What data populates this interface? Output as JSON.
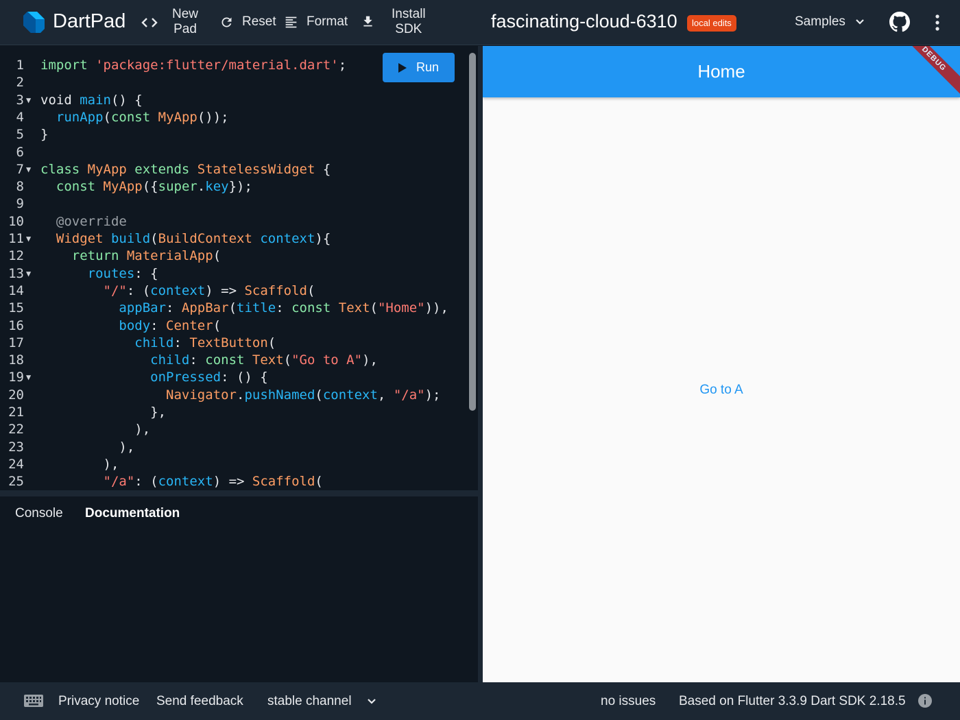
{
  "header": {
    "brand": "DartPad",
    "new_pad_line1": "New",
    "new_pad_line2": "Pad",
    "reset_label": "Reset",
    "format_label": "Format",
    "install_line1": "Install",
    "install_line2": "SDK",
    "pad_name": "fascinating-cloud-6310",
    "badge": "local edits",
    "samples_label": "Samples",
    "icons": [
      "dart-logo-icon",
      "code-brackets-icon",
      "refresh-icon",
      "format-align-icon",
      "download-icon",
      "chevron-down-icon",
      "github-icon",
      "more-vert-icon"
    ]
  },
  "editor": {
    "run_label": "Run",
    "lines": [
      {
        "n": "1",
        "fold": false,
        "tokens": [
          [
            "k-key",
            "import "
          ],
          [
            "k-str",
            "'package:flutter/material.dart'"
          ],
          [
            "k-p",
            ";"
          ]
        ]
      },
      {
        "n": "2",
        "fold": false,
        "tokens": []
      },
      {
        "n": "3",
        "fold": true,
        "tokens": [
          [
            "k-p",
            "void "
          ],
          [
            "k-fn",
            "main"
          ],
          [
            "k-p",
            "() {"
          ]
        ]
      },
      {
        "n": "4",
        "fold": false,
        "tokens": [
          [
            "k-p",
            "  "
          ],
          [
            "k-fn",
            "runApp"
          ],
          [
            "k-p",
            "("
          ],
          [
            "k-kw",
            "const "
          ],
          [
            "k-cls",
            "MyApp"
          ],
          [
            "k-p",
            "());"
          ]
        ]
      },
      {
        "n": "5",
        "fold": false,
        "tokens": [
          [
            "k-p",
            "}"
          ]
        ]
      },
      {
        "n": "6",
        "fold": false,
        "tokens": []
      },
      {
        "n": "7",
        "fold": true,
        "tokens": [
          [
            "k-kw",
            "class "
          ],
          [
            "k-cls",
            "MyApp "
          ],
          [
            "k-kw",
            "extends "
          ],
          [
            "k-cls",
            "StatelessWidget"
          ],
          [
            "k-p",
            " {"
          ]
        ]
      },
      {
        "n": "8",
        "fold": false,
        "tokens": [
          [
            "k-p",
            "  "
          ],
          [
            "k-kw",
            "const "
          ],
          [
            "k-cls",
            "MyApp"
          ],
          [
            "k-p",
            "({"
          ],
          [
            "k-kw",
            "super"
          ],
          [
            "k-p",
            "."
          ],
          [
            "k-fn",
            "key"
          ],
          [
            "k-p",
            "});"
          ]
        ]
      },
      {
        "n": "9",
        "fold": false,
        "tokens": []
      },
      {
        "n": "10",
        "fold": false,
        "tokens": [
          [
            "k-p",
            "  "
          ],
          [
            "k-cm",
            "@override"
          ]
        ]
      },
      {
        "n": "11",
        "fold": true,
        "tokens": [
          [
            "k-p",
            "  "
          ],
          [
            "k-cls",
            "Widget "
          ],
          [
            "k-fn",
            "build"
          ],
          [
            "k-p",
            "("
          ],
          [
            "k-cls",
            "BuildContext "
          ],
          [
            "k-fn",
            "context"
          ],
          [
            "k-p",
            "){"
          ]
        ]
      },
      {
        "n": "12",
        "fold": false,
        "tokens": [
          [
            "k-p",
            "    "
          ],
          [
            "k-kw",
            "return "
          ],
          [
            "k-cls",
            "MaterialApp"
          ],
          [
            "k-p",
            "("
          ]
        ]
      },
      {
        "n": "13",
        "fold": true,
        "tokens": [
          [
            "k-p",
            "      "
          ],
          [
            "k-fn",
            "routes"
          ],
          [
            "k-p",
            ": {"
          ]
        ]
      },
      {
        "n": "14",
        "fold": false,
        "tokens": [
          [
            "k-p",
            "        "
          ],
          [
            "k-str",
            "\"/\""
          ],
          [
            "k-p",
            ": ("
          ],
          [
            "k-fn",
            "context"
          ],
          [
            "k-p",
            ") => "
          ],
          [
            "k-cls",
            "Scaffold"
          ],
          [
            "k-p",
            "("
          ]
        ]
      },
      {
        "n": "15",
        "fold": false,
        "tokens": [
          [
            "k-p",
            "          "
          ],
          [
            "k-fn",
            "appBar"
          ],
          [
            "k-p",
            ": "
          ],
          [
            "k-cls",
            "AppBar"
          ],
          [
            "k-p",
            "("
          ],
          [
            "k-fn",
            "title"
          ],
          [
            "k-p",
            ": "
          ],
          [
            "k-kw",
            "const "
          ],
          [
            "k-cls",
            "Text"
          ],
          [
            "k-p",
            "("
          ],
          [
            "k-str",
            "\"Home\""
          ],
          [
            "k-p",
            ")),"
          ]
        ]
      },
      {
        "n": "16",
        "fold": false,
        "tokens": [
          [
            "k-p",
            "          "
          ],
          [
            "k-fn",
            "body"
          ],
          [
            "k-p",
            ": "
          ],
          [
            "k-cls",
            "Center"
          ],
          [
            "k-p",
            "("
          ]
        ]
      },
      {
        "n": "17",
        "fold": false,
        "tokens": [
          [
            "k-p",
            "            "
          ],
          [
            "k-fn",
            "child"
          ],
          [
            "k-p",
            ": "
          ],
          [
            "k-cls",
            "TextButton"
          ],
          [
            "k-p",
            "("
          ]
        ]
      },
      {
        "n": "18",
        "fold": false,
        "tokens": [
          [
            "k-p",
            "              "
          ],
          [
            "k-fn",
            "child"
          ],
          [
            "k-p",
            ": "
          ],
          [
            "k-kw",
            "const "
          ],
          [
            "k-cls",
            "Text"
          ],
          [
            "k-p",
            "("
          ],
          [
            "k-str",
            "\"Go to A\""
          ],
          [
            "k-p",
            "),"
          ]
        ]
      },
      {
        "n": "19",
        "fold": true,
        "tokens": [
          [
            "k-p",
            "              "
          ],
          [
            "k-fn",
            "onPressed"
          ],
          [
            "k-p",
            ": () {"
          ]
        ]
      },
      {
        "n": "20",
        "fold": false,
        "tokens": [
          [
            "k-p",
            "                "
          ],
          [
            "k-cls",
            "Navigator"
          ],
          [
            "k-p",
            "."
          ],
          [
            "k-fn",
            "pushNamed"
          ],
          [
            "k-p",
            "("
          ],
          [
            "k-fn",
            "context"
          ],
          [
            "k-p",
            ", "
          ],
          [
            "k-str",
            "\"/a\""
          ],
          [
            "k-p",
            ");"
          ]
        ]
      },
      {
        "n": "21",
        "fold": false,
        "tokens": [
          [
            "k-p",
            "              },"
          ]
        ]
      },
      {
        "n": "22",
        "fold": false,
        "tokens": [
          [
            "k-p",
            "            ),"
          ]
        ]
      },
      {
        "n": "23",
        "fold": false,
        "tokens": [
          [
            "k-p",
            "          ),"
          ]
        ]
      },
      {
        "n": "24",
        "fold": false,
        "tokens": [
          [
            "k-p",
            "        ),"
          ]
        ]
      },
      {
        "n": "25",
        "fold": false,
        "tokens": [
          [
            "k-p",
            "        "
          ],
          [
            "k-str",
            "\"/a\""
          ],
          [
            "k-p",
            ": ("
          ],
          [
            "k-fn",
            "context"
          ],
          [
            "k-p",
            ") => "
          ],
          [
            "k-cls",
            "Scaffold"
          ],
          [
            "k-p",
            "("
          ]
        ]
      }
    ]
  },
  "console": {
    "tab_console": "Console",
    "tab_docs": "Documentation"
  },
  "preview": {
    "appbar_title": "Home",
    "debug_banner": "DEBUG",
    "button_label": "Go to A"
  },
  "footer": {
    "privacy": "Privacy notice",
    "feedback": "Send feedback",
    "channel": "stable channel",
    "issues": "no issues",
    "version": "Based on Flutter 3.3.9 Dart SDK 2.18.5"
  },
  "colors": {
    "header_bg": "#1c2733",
    "editor_bg": "#0f1720",
    "run_button": "#1e88e5",
    "appbar": "#2196f3",
    "badge": "#e64a19"
  }
}
